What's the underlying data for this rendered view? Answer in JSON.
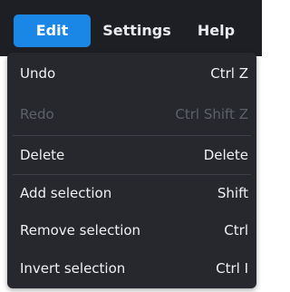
{
  "menubar": {
    "items": [
      {
        "label": "Edit",
        "active": true
      },
      {
        "label": "Settings",
        "active": false
      },
      {
        "label": "Help",
        "active": false
      }
    ]
  },
  "edit_menu": {
    "items": [
      {
        "label": "Undo",
        "shortcut": "Ctrl Z",
        "enabled": true
      },
      {
        "label": "Redo",
        "shortcut": "Ctrl Shift Z",
        "enabled": false
      },
      {
        "label": "Delete",
        "shortcut": "Delete",
        "enabled": true
      },
      {
        "label": "Add selection",
        "shortcut": "Shift",
        "enabled": true
      },
      {
        "label": "Remove selection",
        "shortcut": "Ctrl",
        "enabled": true
      },
      {
        "label": "Invert selection",
        "shortcut": "Ctrl I",
        "enabled": true
      }
    ]
  },
  "colors": {
    "menubar_bg": "#1d1f24",
    "active_accent": "#1a86e6",
    "dropdown_bg": "#26282e",
    "text": "#f0f1f3",
    "disabled_text": "#5d6168"
  }
}
